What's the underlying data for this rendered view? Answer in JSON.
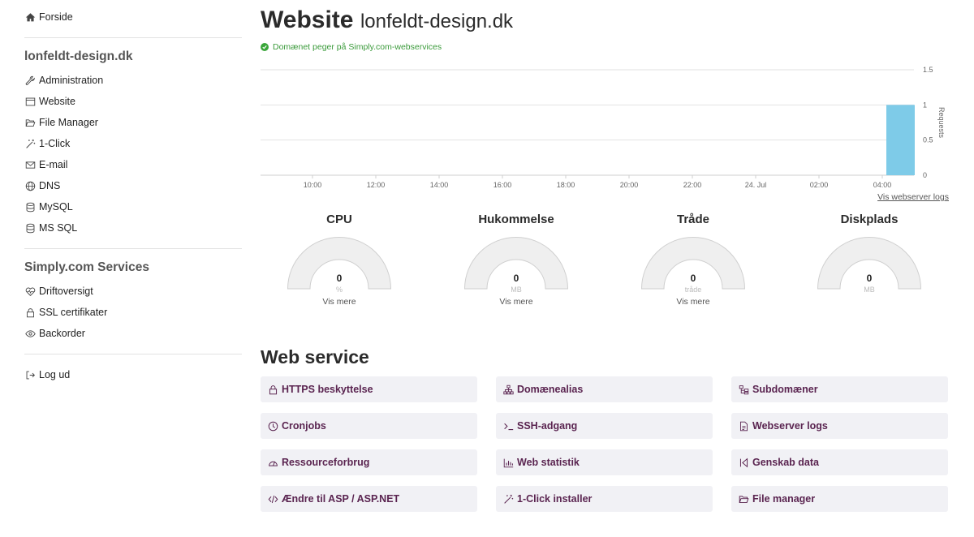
{
  "sidebar": {
    "home": {
      "label": "Forside",
      "icon": "home-icon"
    },
    "domain_title": "lonfeldt-design.dk",
    "domain_items": [
      {
        "label": "Administration",
        "icon": "wrench-icon"
      },
      {
        "label": "Website",
        "icon": "browser-window-icon"
      },
      {
        "label": "File Manager",
        "icon": "folder-open-icon"
      },
      {
        "label": "1-Click",
        "icon": "magic-wand-icon"
      },
      {
        "label": "E-mail",
        "icon": "envelope-icon"
      },
      {
        "label": "DNS",
        "icon": "globe-icon"
      },
      {
        "label": "MySQL",
        "icon": "database-icon"
      },
      {
        "label": "MS SQL",
        "icon": "database-icon"
      }
    ],
    "services_title": "Simply.com Services",
    "service_items": [
      {
        "label": "Driftoversigt",
        "icon": "heartbeat-icon"
      },
      {
        "label": "SSL certifikater",
        "icon": "lock-icon"
      },
      {
        "label": "Backorder",
        "icon": "eye-icon"
      }
    ],
    "logout": {
      "label": "Log ud",
      "icon": "logout-icon"
    }
  },
  "header": {
    "title": "Website",
    "domain": "lonfeldt-design.dk",
    "status": "Domænet peger på Simply.com-webservices",
    "status_color": "#3a9a3a"
  },
  "chart_data": {
    "type": "bar",
    "x_ticks": [
      "10:00",
      "12:00",
      "14:00",
      "16:00",
      "18:00",
      "20:00",
      "22:00",
      "24. Jul",
      "02:00",
      "04:00"
    ],
    "y_ticks": [
      "0",
      "0.5",
      "1",
      "1.5"
    ],
    "ylabel": "Requests",
    "ylim": [
      0,
      1.5
    ],
    "series": [
      {
        "x": "04:00",
        "values": [
          1
        ]
      }
    ],
    "bar_color": "#7ecbe8",
    "grid": true
  },
  "chart_link": "Vis webserver logs",
  "gauges": [
    {
      "title": "CPU",
      "value": "0",
      "unit": "%",
      "more": "Vis mere"
    },
    {
      "title": "Hukommelse",
      "value": "0",
      "unit": "MB",
      "more": "Vis mere"
    },
    {
      "title": "Tråde",
      "value": "0",
      "unit": "tråde",
      "more": "Vis mere"
    },
    {
      "title": "Diskplads",
      "value": "0",
      "unit": "MB",
      "more": ""
    }
  ],
  "web_service": {
    "title": "Web service",
    "buttons": [
      {
        "label": "HTTPS beskyttelse",
        "icon": "lock-icon"
      },
      {
        "label": "Domænealias",
        "icon": "sitemap-icon"
      },
      {
        "label": "Subdomæner",
        "icon": "subdomain-icon"
      },
      {
        "label": "Cronjobs",
        "icon": "clock-icon"
      },
      {
        "label": "SSH-adgang",
        "icon": "terminal-icon"
      },
      {
        "label": "Webserver logs",
        "icon": "file-icon"
      },
      {
        "label": "Ressourceforbrug",
        "icon": "gauge-icon"
      },
      {
        "label": "Web statistik",
        "icon": "bar-chart-icon"
      },
      {
        "label": "Genskab data",
        "icon": "restore-icon"
      },
      {
        "label": "Ændre til ASP / ASP.NET",
        "icon": "code-icon"
      },
      {
        "label": "1-Click installer",
        "icon": "magic-wand-icon"
      },
      {
        "label": "File manager",
        "icon": "folder-open-icon"
      }
    ]
  }
}
